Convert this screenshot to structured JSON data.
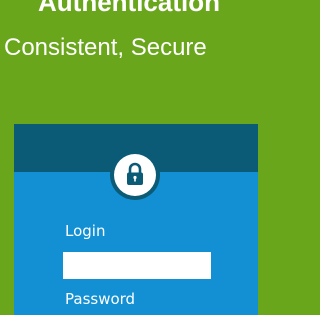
{
  "hero": {
    "title": "Authentication",
    "subtitle": "Consistent, Secure"
  },
  "login_form": {
    "icon": "lock-icon",
    "login_label": "Login",
    "login_value": "",
    "password_label": "Password"
  },
  "colors": {
    "page_background": "#69a61c",
    "card_background": "#1290d3",
    "card_header": "#0b5a76",
    "text": "#ffffff"
  }
}
